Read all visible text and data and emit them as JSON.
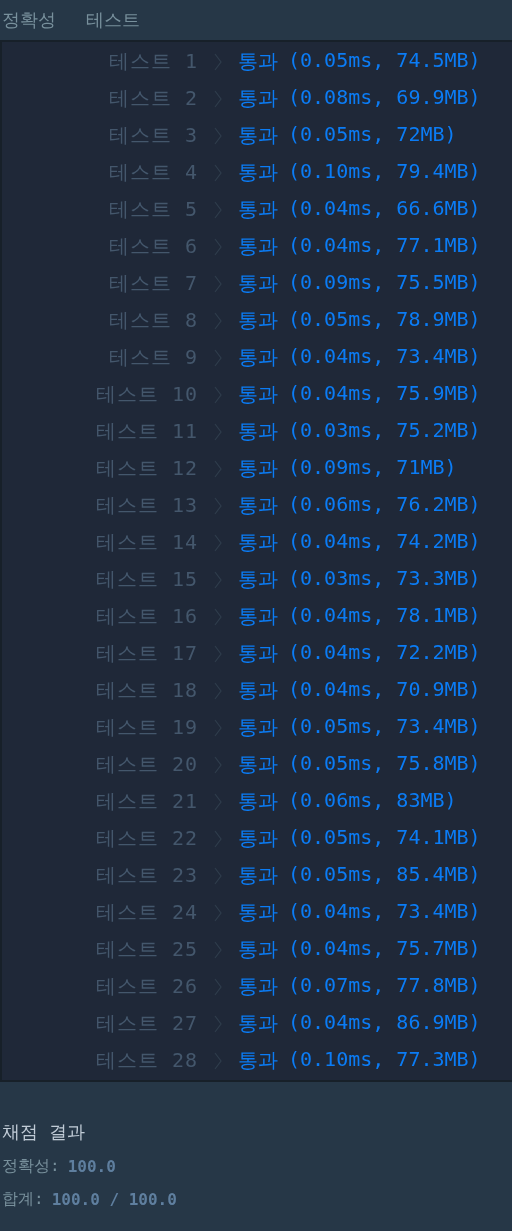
{
  "header": [
    "정확성",
    "테스트"
  ],
  "tests": [
    {
      "label": "테스트 1",
      "verdict": "통과",
      "detail": "(0.05ms, 74.5MB)"
    },
    {
      "label": "테스트 2",
      "verdict": "통과",
      "detail": "(0.08ms, 69.9MB)"
    },
    {
      "label": "테스트 3",
      "verdict": "통과",
      "detail": "(0.05ms, 72MB)"
    },
    {
      "label": "테스트 4",
      "verdict": "통과",
      "detail": "(0.10ms, 79.4MB)"
    },
    {
      "label": "테스트 5",
      "verdict": "통과",
      "detail": "(0.04ms, 66.6MB)"
    },
    {
      "label": "테스트 6",
      "verdict": "통과",
      "detail": "(0.04ms, 77.1MB)"
    },
    {
      "label": "테스트 7",
      "verdict": "통과",
      "detail": "(0.09ms, 75.5MB)"
    },
    {
      "label": "테스트 8",
      "verdict": "통과",
      "detail": "(0.05ms, 78.9MB)"
    },
    {
      "label": "테스트 9",
      "verdict": "통과",
      "detail": "(0.04ms, 73.4MB)"
    },
    {
      "label": "테스트 10",
      "verdict": "통과",
      "detail": "(0.04ms, 75.9MB)"
    },
    {
      "label": "테스트 11",
      "verdict": "통과",
      "detail": "(0.03ms, 75.2MB)"
    },
    {
      "label": "테스트 12",
      "verdict": "통과",
      "detail": "(0.09ms, 71MB)"
    },
    {
      "label": "테스트 13",
      "verdict": "통과",
      "detail": "(0.06ms, 76.2MB)"
    },
    {
      "label": "테스트 14",
      "verdict": "통과",
      "detail": "(0.04ms, 74.2MB)"
    },
    {
      "label": "테스트 15",
      "verdict": "통과",
      "detail": "(0.03ms, 73.3MB)"
    },
    {
      "label": "테스트 16",
      "verdict": "통과",
      "detail": "(0.04ms, 78.1MB)"
    },
    {
      "label": "테스트 17",
      "verdict": "통과",
      "detail": "(0.04ms, 72.2MB)"
    },
    {
      "label": "테스트 18",
      "verdict": "통과",
      "detail": "(0.04ms, 70.9MB)"
    },
    {
      "label": "테스트 19",
      "verdict": "통과",
      "detail": "(0.05ms, 73.4MB)"
    },
    {
      "label": "테스트 20",
      "verdict": "통과",
      "detail": "(0.05ms, 75.8MB)"
    },
    {
      "label": "테스트 21",
      "verdict": "통과",
      "detail": "(0.06ms, 83MB)"
    },
    {
      "label": "테스트 22",
      "verdict": "통과",
      "detail": "(0.05ms, 74.1MB)"
    },
    {
      "label": "테스트 23",
      "verdict": "통과",
      "detail": "(0.05ms, 85.4MB)"
    },
    {
      "label": "테스트 24",
      "verdict": "통과",
      "detail": "(0.04ms, 73.4MB)"
    },
    {
      "label": "테스트 25",
      "verdict": "통과",
      "detail": "(0.04ms, 75.7MB)"
    },
    {
      "label": "테스트 26",
      "verdict": "통과",
      "detail": "(0.07ms, 77.8MB)"
    },
    {
      "label": "테스트 27",
      "verdict": "통과",
      "detail": "(0.04ms, 86.9MB)"
    },
    {
      "label": "테스트 28",
      "verdict": "통과",
      "detail": "(0.10ms, 77.3MB)"
    }
  ],
  "summary": {
    "title": "채점 결과",
    "lines": [
      {
        "label": "정확성:",
        "value": "100.0"
      },
      {
        "label": "합계:",
        "value": "100.0 / 100.0"
      }
    ]
  }
}
